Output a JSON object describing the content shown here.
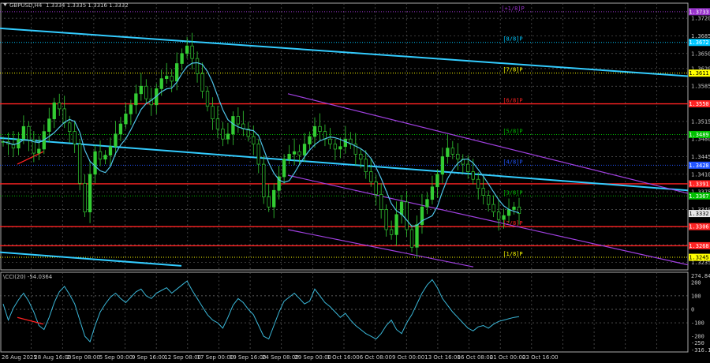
{
  "chart_data": [
    {
      "type": "candlestick",
      "title": "GBPUSD,H4",
      "ohlc_label": "1.3334 1.3335 1.3316 1.3332",
      "price_axis": {
        "ylim": [
          1.322,
          1.375
        ],
        "ticks": [
          "1.3720",
          "1.3685",
          "1.3650",
          "1.3620",
          "1.3585",
          "1.3550",
          "1.3515",
          "1.3480",
          "1.3445",
          "1.3410",
          "1.3375",
          "1.3340",
          "1.3305",
          "1.3270",
          "1.3235"
        ]
      },
      "time_labels": [
        "26 Aug 2025",
        "28 Aug 16:00",
        "2 Sep 08:00",
        "5 Sep 00:00",
        "9 Sep 16:00",
        "12 Sep 08:00",
        "17 Sep 00:00",
        "19 Sep 16:00",
        "24 Sep 08:00",
        "29 Sep 00:00",
        "1 Oct 16:00",
        "6 Oct 08:00",
        "9 Oct 00:00",
        "13 Oct 16:00",
        "16 Oct 08:00",
        "21 Oct 00:00",
        "23 Oct 16:00"
      ],
      "close_series": [
        1.3475,
        1.347,
        1.3462,
        1.348,
        1.3505,
        1.3478,
        1.3452,
        1.346,
        1.3495,
        1.352,
        1.3552,
        1.354,
        1.3512,
        1.3495,
        1.347,
        1.3392,
        1.3335,
        1.341,
        1.3455,
        1.344,
        1.3448,
        1.3465,
        1.349,
        1.351,
        1.353,
        1.3548,
        1.357,
        1.3585,
        1.356,
        1.3548,
        1.358,
        1.36,
        1.3605,
        1.3595,
        1.363,
        1.365,
        1.3665,
        1.364,
        1.361,
        1.3575,
        1.3545,
        1.352,
        1.35,
        1.348,
        1.349,
        1.3525,
        1.351,
        1.35,
        1.3485,
        1.347,
        1.343,
        1.3365,
        1.3345,
        1.3378,
        1.3405,
        1.344,
        1.345,
        1.3455,
        1.3448,
        1.347,
        1.3485,
        1.3505,
        1.3495,
        1.348,
        1.347,
        1.346,
        1.3465,
        1.348,
        1.347,
        1.345,
        1.344,
        1.3415,
        1.3395,
        1.337,
        1.334,
        1.33,
        1.329,
        1.333,
        1.3355,
        1.33,
        1.3265,
        1.331,
        1.3345,
        1.336,
        1.3385,
        1.341,
        1.3445,
        1.3462,
        1.345,
        1.344,
        1.343,
        1.3415,
        1.34,
        1.3382,
        1.3368,
        1.335,
        1.3335,
        1.332,
        1.3328,
        1.334,
        1.3345,
        1.3332
      ],
      "levels": [
        {
          "price": 1.3733,
          "tag": "1.3733",
          "label": "[+1/8]P",
          "color": "#9933cc"
        },
        {
          "price": 1.3672,
          "tag": "1.3672",
          "label": "[8/8]P",
          "color": "#00c8ff"
        },
        {
          "price": 1.3611,
          "tag": "1.3611",
          "label": "[7/8]P",
          "color": "#ffff00"
        },
        {
          "price": 1.355,
          "tag": "1.3550",
          "label": "[6/8]P",
          "color": "#ff2222"
        },
        {
          "price": 1.3489,
          "tag": "1.3489",
          "label": "[5/8]P",
          "color": "#00c000"
        },
        {
          "price": 1.3428,
          "tag": "1.3428",
          "label": "[4/8]P",
          "color": "#2255ff"
        },
        {
          "price": 1.3391,
          "tag": "1.3391",
          "label": "",
          "color": "#ff2222"
        },
        {
          "price": 1.3367,
          "tag": "1.3367",
          "label": "[3/8]P",
          "color": "#00c000"
        },
        {
          "price": 1.3306,
          "tag": "1.3306",
          "label": "[2/8]P",
          "color": "#ff2222"
        },
        {
          "price": 1.3268,
          "tag": "1.3268",
          "label": "",
          "color": "#ff2222"
        },
        {
          "price": 1.3245,
          "tag": "1.3245",
          "label": "[1/8]P",
          "color": "#ffff00"
        }
      ],
      "current_price": "1.3332",
      "current_price_color": "#ffffff"
    },
    {
      "type": "line",
      "title": "\\CCI(20) -54.0364",
      "ylim": [
        -316.1729,
        274.8423
      ],
      "axis_ticks": [
        "274.8423",
        "200",
        "100",
        "0",
        "-100",
        "-200",
        "-250",
        "-316.1729"
      ],
      "values": [
        40,
        -80,
        10,
        70,
        120,
        60,
        -20,
        -120,
        -150,
        -60,
        50,
        130,
        170,
        110,
        40,
        -80,
        -200,
        -240,
        -120,
        -20,
        40,
        90,
        120,
        80,
        50,
        90,
        130,
        150,
        100,
        80,
        120,
        140,
        160,
        120,
        150,
        180,
        210,
        140,
        80,
        20,
        -40,
        -80,
        -100,
        -140,
        -60,
        30,
        80,
        50,
        0,
        -40,
        -120,
        -200,
        -220,
        -120,
        -20,
        60,
        90,
        120,
        80,
        40,
        60,
        150,
        100,
        50,
        20,
        -20,
        -60,
        -30,
        -80,
        -120,
        -150,
        -180,
        -200,
        -220,
        -180,
        -120,
        -80,
        -150,
        -180,
        -100,
        -40,
        40,
        120,
        180,
        220,
        160,
        80,
        30,
        -20,
        -60,
        -100,
        -140,
        -160,
        -130,
        -120,
        -140,
        -110,
        -90,
        -80,
        -70,
        -60,
        -54
      ],
      "annotation_segment": true
    }
  ]
}
